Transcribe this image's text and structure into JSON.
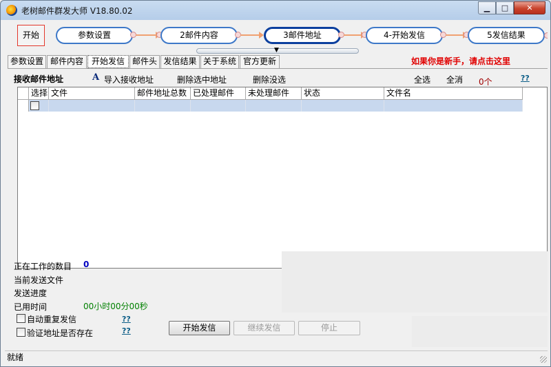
{
  "window": {
    "title": "老树邮件群发大师 V18.80.02",
    "min_icon": "minimize-icon",
    "max_icon": "maximize-icon",
    "close_icon": "close-icon"
  },
  "workflow": {
    "start_label": "开始",
    "steps": [
      "参数设置",
      "2邮件内容",
      "3邮件地址",
      "4-开始发信",
      "5发信结果"
    ],
    "active_step": "3邮件地址"
  },
  "tabs": [
    "参数设置",
    "邮件内容",
    "开始发信",
    "邮件头",
    "发信结果",
    "关于系统",
    "官方更新"
  ],
  "selected_tab": "开始发信",
  "newbie_link": "如果你是新手，请点击这里",
  "toolbar": {
    "section_label": "接收邮件地址",
    "import_icon": "A",
    "import_label": "导入接收地址",
    "delete_selected_label": "删除选中地址",
    "delete_unselected_label": "删除没选",
    "select_all_label": "全选",
    "deselect_all_label": "全消",
    "count_label": "0个",
    "help_label": "??"
  },
  "table": {
    "columns": [
      "选择",
      "文件",
      "邮件地址总数",
      "已处理邮件",
      "未处理邮件",
      "状态",
      "文件名"
    ],
    "rows": [
      {
        "checked": false,
        "file": "",
        "total": "",
        "processed": "",
        "unprocessed": "",
        "status": "",
        "filename": ""
      }
    ]
  },
  "status": {
    "working_count_label": "正在工作的数目",
    "working_count_value": "0",
    "current_file_label": "当前发送文件",
    "progress_label": "发送进度",
    "elapsed_label": "已用时间",
    "elapsed_value": "00小时00分00秒"
  },
  "options": {
    "auto_resend_label": "自动重复发信",
    "auto_resend_help": "??",
    "verify_label": "验证地址是否存在",
    "verify_help": "??"
  },
  "buttons": {
    "start_send": "开始发信",
    "continue_send": "继续发信",
    "stop": "停止"
  },
  "statusbar_text": "就绪"
}
